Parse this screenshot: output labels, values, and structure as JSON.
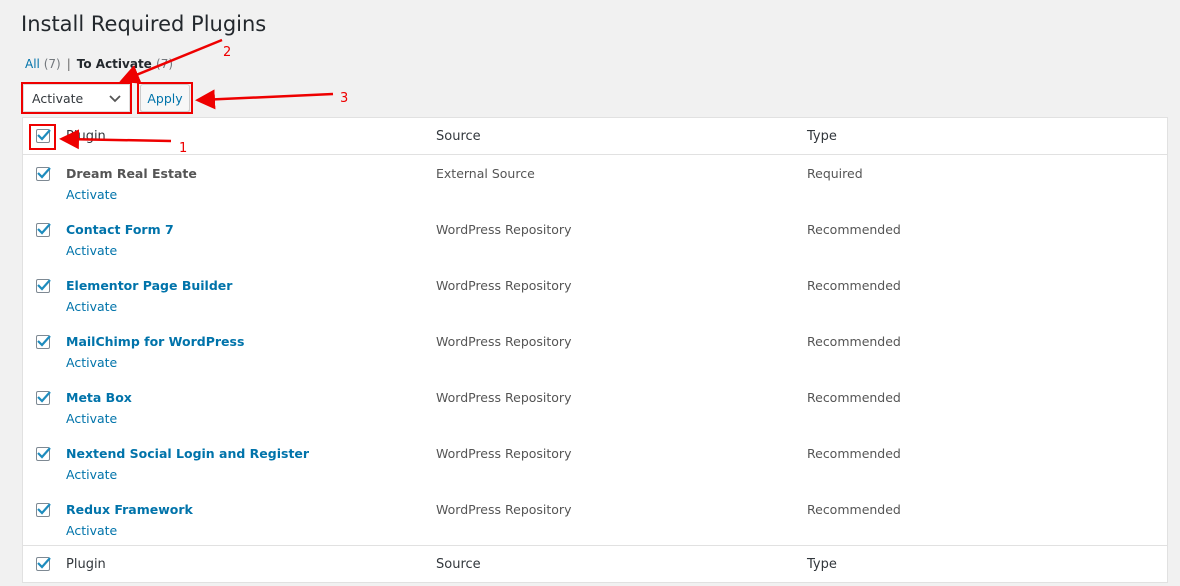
{
  "page_title": "Install Required Plugins",
  "filters": {
    "all_label": "All",
    "all_count": "(7)",
    "separator": "|",
    "to_activate_label": "To Activate",
    "to_activate_count": "(7)"
  },
  "bulk_actions": {
    "selected": "Activate",
    "apply_label": "Apply"
  },
  "table": {
    "headers": [
      "Plugin",
      "Source",
      "Type"
    ],
    "footers": [
      "Plugin",
      "Source",
      "Type"
    ],
    "rows": [
      {
        "name": "Dream Real Estate",
        "name_is_link": false,
        "action": "Activate",
        "source": "External Source",
        "type": "Required",
        "checked": true
      },
      {
        "name": "Contact Form 7",
        "name_is_link": true,
        "action": "Activate",
        "source": "WordPress Repository",
        "type": "Recommended",
        "checked": true
      },
      {
        "name": "Elementor Page Builder",
        "name_is_link": true,
        "action": "Activate",
        "source": "WordPress Repository",
        "type": "Recommended",
        "checked": true
      },
      {
        "name": "MailChimp for WordPress",
        "name_is_link": true,
        "action": "Activate",
        "source": "WordPress Repository",
        "type": "Recommended",
        "checked": true
      },
      {
        "name": "Meta Box",
        "name_is_link": true,
        "action": "Activate",
        "source": "WordPress Repository",
        "type": "Recommended",
        "checked": true
      },
      {
        "name": "Nextend Social Login and Register",
        "name_is_link": true,
        "action": "Activate",
        "source": "WordPress Repository",
        "type": "Recommended",
        "checked": true
      },
      {
        "name": "Redux Framework",
        "name_is_link": true,
        "action": "Activate",
        "source": "WordPress Repository",
        "type": "Recommended",
        "checked": true
      }
    ]
  },
  "annotations": {
    "step1": "1",
    "step2": "2",
    "step3": "3",
    "color": "#e00000"
  },
  "colors": {
    "link": "#0073aa",
    "checkbox": "#1e8cbe",
    "background": "#f1f1f1"
  }
}
